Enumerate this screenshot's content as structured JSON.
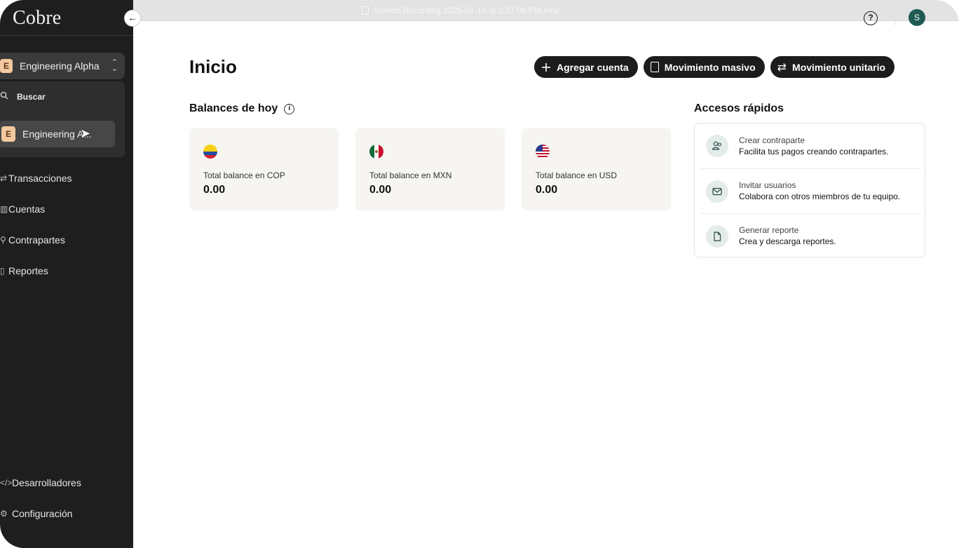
{
  "window": {
    "recording_title": "Screen Recording 2025-01-15 at 2.37.08 PM.mov"
  },
  "sidebar": {
    "brand": "Cobre",
    "workspace": {
      "badge": "E",
      "name": "Engineering Alpha"
    },
    "dropdown": {
      "search_label": "Buscar",
      "option": {
        "badge": "E",
        "name": "Engineering A..."
      }
    },
    "nav": [
      {
        "label": "Transacciones",
        "icon": "arrows-icon"
      },
      {
        "label": "Cuentas",
        "icon": "bank-icon"
      },
      {
        "label": "Contrapartes",
        "icon": "users-icon"
      },
      {
        "label": "Reportes",
        "icon": "report-icon"
      }
    ],
    "nav_bottom": [
      {
        "label": "Desarrolladores",
        "icon": "code-icon"
      },
      {
        "label": "Configuración",
        "icon": "gear-icon"
      }
    ]
  },
  "header": {
    "avatar_initial": "S"
  },
  "main": {
    "title": "Inicio",
    "actions": [
      {
        "label": "Agregar cuenta",
        "icon": "plus-icon"
      },
      {
        "label": "Movimiento masivo",
        "icon": "file-icon"
      },
      {
        "label": "Movimiento unitario",
        "icon": "swap-icon"
      }
    ],
    "balances_title": "Balances de hoy",
    "balances": [
      {
        "label": "Total balance en COP",
        "value": "0.00",
        "flag": "colombia-flag-icon"
      },
      {
        "label": "Total balance en MXN",
        "value": "0.00",
        "flag": "mexico-flag-icon"
      },
      {
        "label": "Total balance en USD",
        "value": "0.00",
        "flag": "usa-flag-icon"
      }
    ],
    "quick_access_title": "Accesos rápidos",
    "quick_access": [
      {
        "name": "Crear contraparte",
        "description": "Facilita tus pagos creando contrapartes.",
        "icon": "user-plus-icon"
      },
      {
        "name": "Invitar usuarios",
        "description": "Colabora con otros miembros de tu equipo.",
        "icon": "mail-icon"
      },
      {
        "name": "Generar reporte",
        "description": "Crea y descarga reportes.",
        "icon": "document-icon"
      }
    ]
  },
  "colors": {
    "sidebar_bg": "#1e1e1e",
    "button_bg": "#1c1c1c",
    "card_bg": "#f6f5f2",
    "avatar_bg": "#1f5b53"
  }
}
